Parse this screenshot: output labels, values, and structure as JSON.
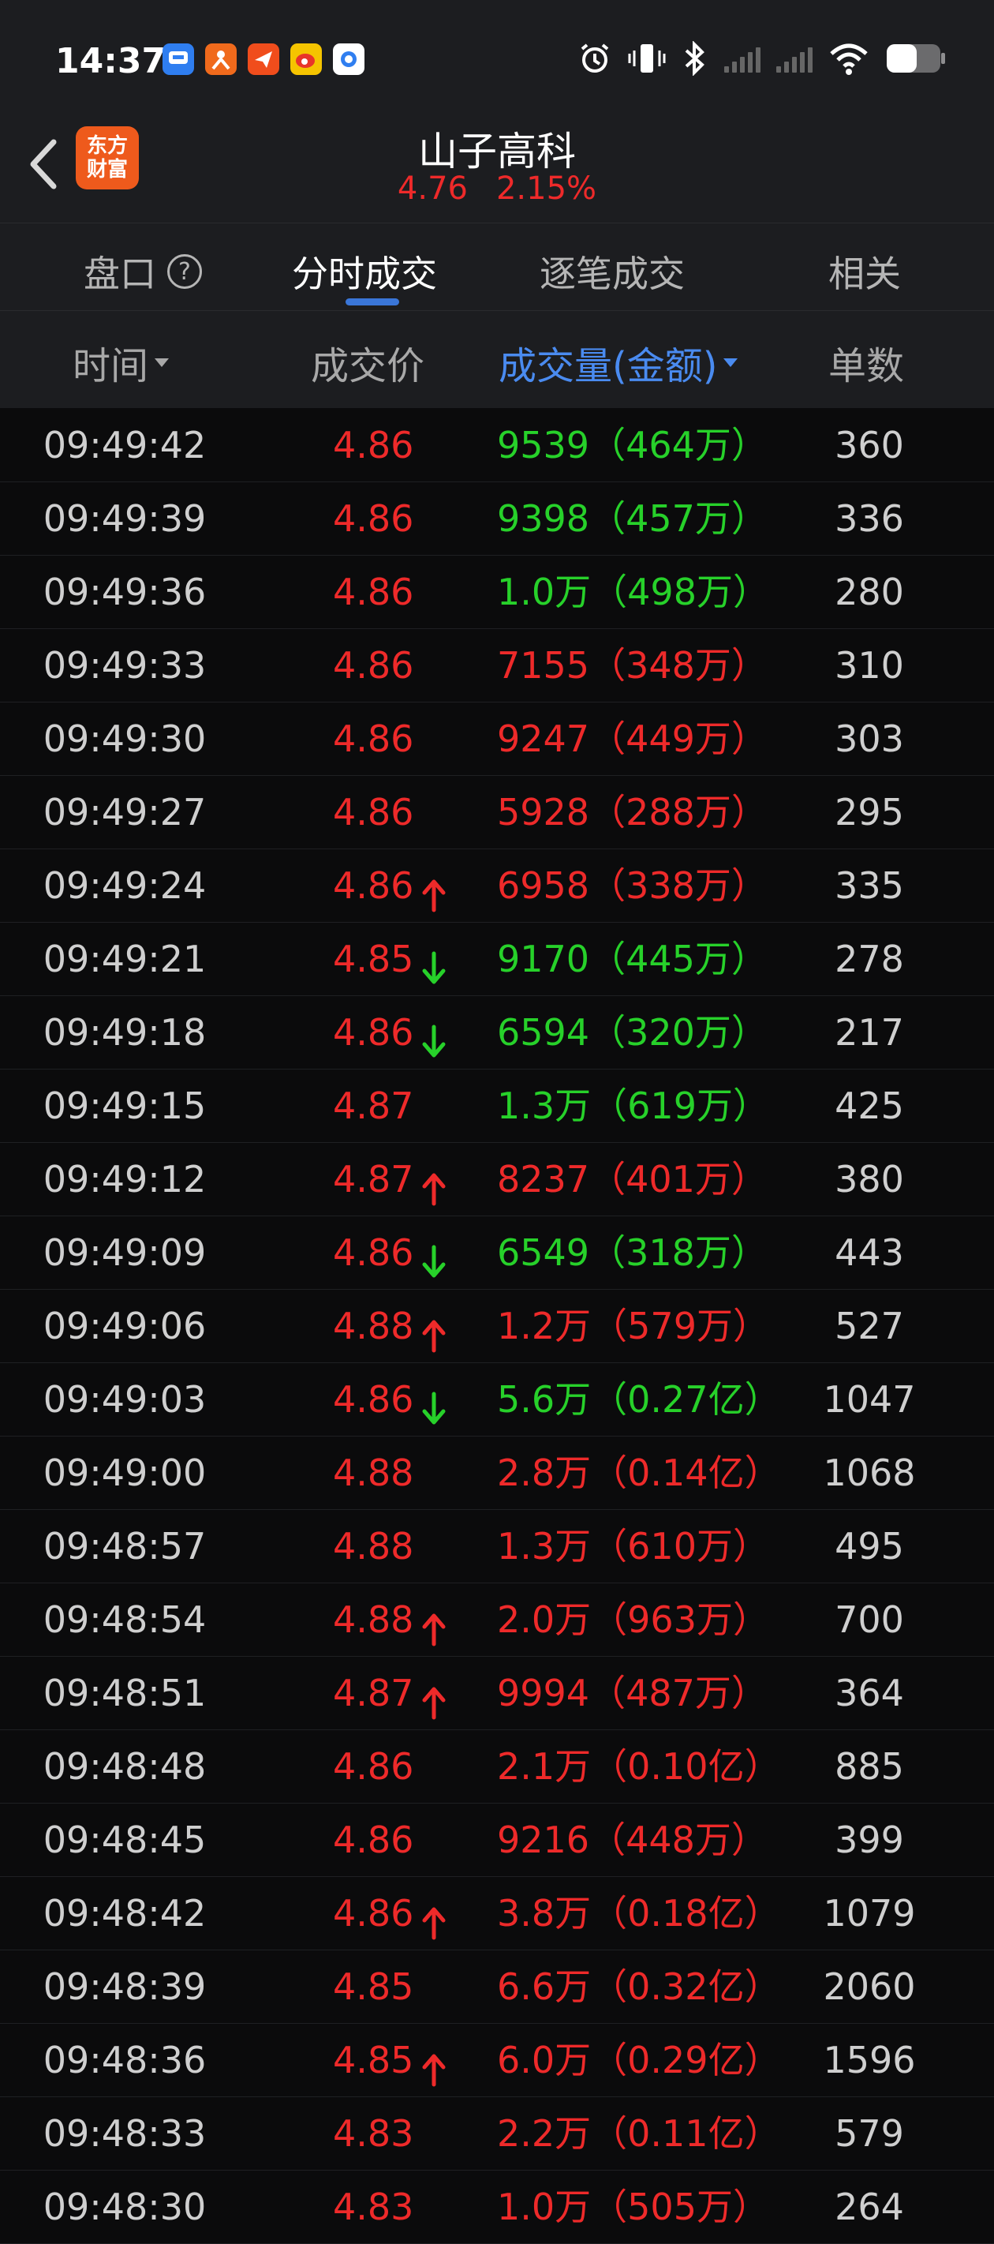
{
  "status_bar": {
    "time": "14:37",
    "app_icons": [
      "chat-app-icon",
      "person-app-icon",
      "paper-plane-app-icon",
      "weibo-app-icon",
      "circle-app-icon"
    ],
    "indicators": [
      "alarm-icon",
      "vibrate-icon",
      "bluetooth-icon",
      "signal-icon",
      "signal-icon",
      "wifi-icon",
      "battery-icon"
    ]
  },
  "header": {
    "logo_line1": "东方",
    "logo_line2": "财富",
    "stock_name": "山子高科",
    "price": "4.76",
    "change_pct": "2.15%"
  },
  "tabs": [
    {
      "label": "盘口",
      "active": false
    },
    {
      "label": "分时成交",
      "active": true
    },
    {
      "label": "逐笔成交",
      "active": false
    },
    {
      "label": "相关",
      "active": false
    }
  ],
  "columns": {
    "time": "时间",
    "price": "成交价",
    "volume": "成交量(金额)",
    "count": "单数"
  },
  "colors": {
    "up": "#ee2a2a",
    "down": "#27d12a",
    "accent": "#3a76d8"
  },
  "rows": [
    {
      "time": "09:49:42",
      "price": "4.86",
      "arrow": "",
      "volume": "9539（464万）",
      "vol_color": "green",
      "count": "360"
    },
    {
      "time": "09:49:39",
      "price": "4.86",
      "arrow": "",
      "volume": "9398（457万）",
      "vol_color": "green",
      "count": "336"
    },
    {
      "time": "09:49:36",
      "price": "4.86",
      "arrow": "",
      "volume": "1.0万（498万）",
      "vol_color": "green",
      "count": "280"
    },
    {
      "time": "09:49:33",
      "price": "4.86",
      "arrow": "",
      "volume": "7155（348万）",
      "vol_color": "red",
      "count": "310"
    },
    {
      "time": "09:49:30",
      "price": "4.86",
      "arrow": "",
      "volume": "9247（449万）",
      "vol_color": "red",
      "count": "303"
    },
    {
      "time": "09:49:27",
      "price": "4.86",
      "arrow": "",
      "volume": "5928（288万）",
      "vol_color": "red",
      "count": "295"
    },
    {
      "time": "09:49:24",
      "price": "4.86",
      "arrow": "up",
      "volume": "6958（338万）",
      "vol_color": "red",
      "count": "335"
    },
    {
      "time": "09:49:21",
      "price": "4.85",
      "arrow": "down",
      "volume": "9170（445万）",
      "vol_color": "green",
      "count": "278"
    },
    {
      "time": "09:49:18",
      "price": "4.86",
      "arrow": "down",
      "volume": "6594（320万）",
      "vol_color": "green",
      "count": "217"
    },
    {
      "time": "09:49:15",
      "price": "4.87",
      "arrow": "",
      "volume": "1.3万（619万）",
      "vol_color": "green",
      "count": "425"
    },
    {
      "time": "09:49:12",
      "price": "4.87",
      "arrow": "up",
      "volume": "8237（401万）",
      "vol_color": "red",
      "count": "380"
    },
    {
      "time": "09:49:09",
      "price": "4.86",
      "arrow": "down",
      "volume": "6549（318万）",
      "vol_color": "green",
      "count": "443"
    },
    {
      "time": "09:49:06",
      "price": "4.88",
      "arrow": "up",
      "volume": "1.2万（579万）",
      "vol_color": "red",
      "count": "527"
    },
    {
      "time": "09:49:03",
      "price": "4.86",
      "arrow": "down",
      "volume": "5.6万（0.27亿）",
      "vol_color": "green",
      "count": "1047"
    },
    {
      "time": "09:49:00",
      "price": "4.88",
      "arrow": "",
      "volume": "2.8万（0.14亿）",
      "vol_color": "red",
      "count": "1068"
    },
    {
      "time": "09:48:57",
      "price": "4.88",
      "arrow": "",
      "volume": "1.3万（610万）",
      "vol_color": "red",
      "count": "495"
    },
    {
      "time": "09:48:54",
      "price": "4.88",
      "arrow": "up",
      "volume": "2.0万（963万）",
      "vol_color": "red",
      "count": "700"
    },
    {
      "time": "09:48:51",
      "price": "4.87",
      "arrow": "up",
      "volume": "9994（487万）",
      "vol_color": "red",
      "count": "364"
    },
    {
      "time": "09:48:48",
      "price": "4.86",
      "arrow": "",
      "volume": "2.1万（0.10亿）",
      "vol_color": "red",
      "count": "885"
    },
    {
      "time": "09:48:45",
      "price": "4.86",
      "arrow": "",
      "volume": "9216（448万）",
      "vol_color": "red",
      "count": "399"
    },
    {
      "time": "09:48:42",
      "price": "4.86",
      "arrow": "up",
      "volume": "3.8万（0.18亿）",
      "vol_color": "red",
      "count": "1079"
    },
    {
      "time": "09:48:39",
      "price": "4.85",
      "arrow": "",
      "volume": "6.6万（0.32亿）",
      "vol_color": "red",
      "count": "2060"
    },
    {
      "time": "09:48:36",
      "price": "4.85",
      "arrow": "up",
      "volume": "6.0万（0.29亿）",
      "vol_color": "red",
      "count": "1596"
    },
    {
      "time": "09:48:33",
      "price": "4.83",
      "arrow": "",
      "volume": "2.2万（0.11亿）",
      "vol_color": "red",
      "count": "579"
    },
    {
      "time": "09:48:30",
      "price": "4.83",
      "arrow": "",
      "volume": "1.0万（505万）",
      "vol_color": "red",
      "count": "264"
    }
  ]
}
